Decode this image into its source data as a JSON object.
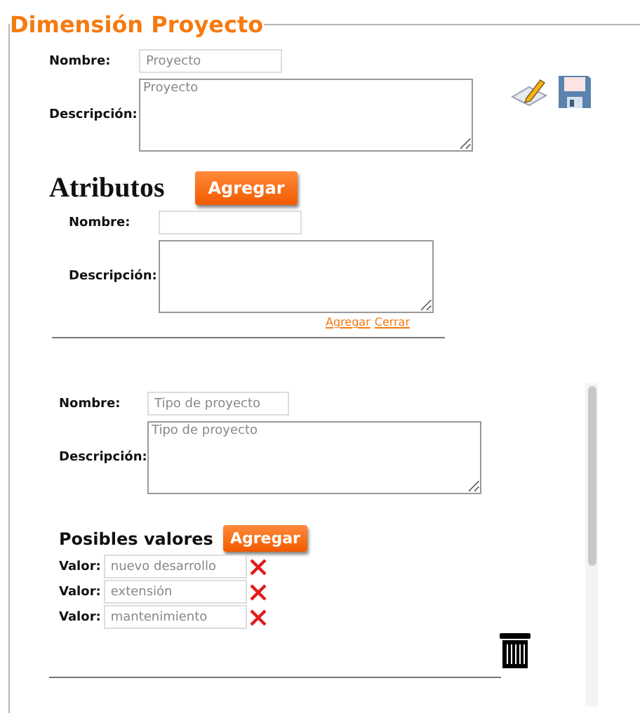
{
  "panel": {
    "legend": "Dimensión Proyecto"
  },
  "dimension": {
    "name_label": "Nombre:",
    "name_value": "Proyecto",
    "description_label": "Descripción:",
    "description_value": "Proyecto"
  },
  "attributes": {
    "heading": "Atributos",
    "add_button": "Agregar",
    "name_label": "Nombre:",
    "description_label": "Descripción:",
    "links": [
      "Agregar",
      "Cerrar"
    ]
  },
  "attribute_items": [
    {
      "name_label": "Nombre:",
      "name_value": "Tipo de proyecto",
      "description_label": "Descripción:",
      "description_value": "Tipo de proyecto",
      "values_heading": "Posibles valores",
      "add_button": "Agregar",
      "values": [
        {
          "label": "Valor:",
          "value": "nuevo desarrollo"
        },
        {
          "label": "Valor:",
          "value": "extensión"
        },
        {
          "label": "Valor:",
          "value": "mantenimiento"
        }
      ]
    }
  ]
}
